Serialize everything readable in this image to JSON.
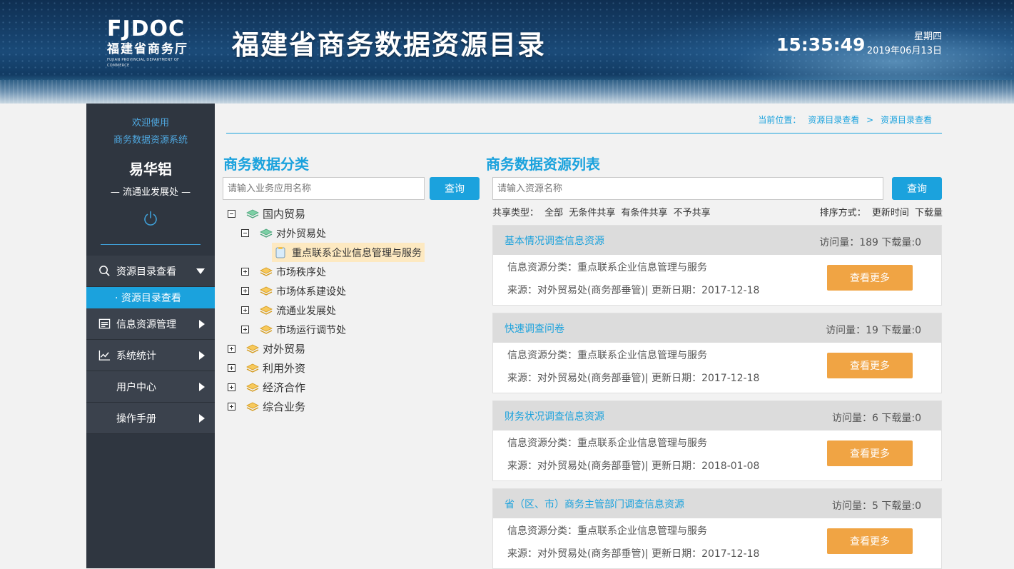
{
  "header": {
    "logo_mark": "FJDOC",
    "logo_name": "福建省商务厅",
    "logo_en": "FUJIAN PROVINCIAL DEPARTMENT OF COMMERCE",
    "title": "福建省商务数据资源目录",
    "time": "15:35:49",
    "weekday": "星期四",
    "date": "2019年06月13日"
  },
  "sidebar": {
    "welcome_line1": "欢迎使用",
    "welcome_line2": "商务数据资源系统",
    "user_name": "易华铝",
    "department": "— 流通业发展处 —",
    "menu": [
      {
        "label": "资源目录查看",
        "icon": "search-icon",
        "expanded": true
      },
      {
        "label": "信息资源管理",
        "icon": "list-icon",
        "expanded": false
      },
      {
        "label": "系统统计",
        "icon": "chart-icon",
        "expanded": false
      },
      {
        "label": "用户中心",
        "icon": "",
        "expanded": false
      },
      {
        "label": "操作手册",
        "icon": "",
        "expanded": false
      }
    ],
    "submenu_active": "· 资源目录查看"
  },
  "breadcrumb": {
    "prefix": "当前位置：",
    "items": [
      "资源目录查看",
      ">",
      "资源目录查看"
    ]
  },
  "category": {
    "title": "商务数据分类",
    "search_placeholder": "请输入业务应用名称",
    "search_button": "查询",
    "tree": [
      {
        "label": "国内贸易",
        "state": "minus"
      },
      {
        "label": "对外贸易处",
        "state": "minus"
      },
      {
        "label": "重点联系企业信息管理与服务",
        "state": "leaf"
      },
      {
        "label": "市场秩序处",
        "state": "plus"
      },
      {
        "label": "市场体系建设处",
        "state": "plus"
      },
      {
        "label": "流通业发展处",
        "state": "plus"
      },
      {
        "label": "市场运行调节处",
        "state": "plus"
      },
      {
        "label": "对外贸易",
        "state": "plus"
      },
      {
        "label": "利用外资",
        "state": "plus"
      },
      {
        "label": "经济合作",
        "state": "plus"
      },
      {
        "label": "综合业务",
        "state": "plus"
      }
    ]
  },
  "resources": {
    "title": "商务数据资源列表",
    "search_placeholder": "请输入资源名称",
    "search_button": "查询",
    "share_type_label": "共享类型：",
    "share_types": [
      "全部",
      "无条件共享",
      "有条件共享",
      "不予共享"
    ],
    "sort_label": "排序方式：",
    "sort_options": [
      "更新时间",
      "下载量"
    ],
    "more_label": "查看更多",
    "cards": [
      {
        "name": "基本情况调查信息资源",
        "stats": "访问量：189   下载量:0",
        "category": "信息资源分类：重点联系企业信息管理与服务",
        "source": "来源：对外贸易处(商务部垂管)| 更新日期：2017-12-18"
      },
      {
        "name": "快速调查问卷",
        "stats": "访问量：19   下载量:0",
        "category": "信息资源分类：重点联系企业信息管理与服务",
        "source": "来源：对外贸易处(商务部垂管)| 更新日期：2017-12-18"
      },
      {
        "name": "财务状况调查信息资源",
        "stats": "访问量：6   下载量:0",
        "category": "信息资源分类：重点联系企业信息管理与服务",
        "source": "来源：对外贸易处(商务部垂管)| 更新日期：2018-01-08"
      },
      {
        "name": "省（区、市）商务主管部门调查信息资源",
        "stats": "访问量：5   下载量:0",
        "category": "信息资源分类：重点联系企业信息管理与服务",
        "source": "来源：对外贸易处(商务部垂管)| 更新日期：2017-12-18"
      }
    ]
  }
}
